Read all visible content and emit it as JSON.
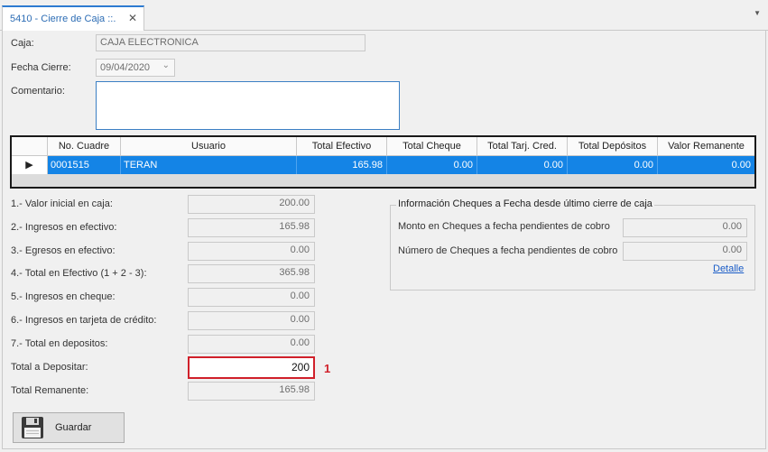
{
  "tab": {
    "title": "5410 - Cierre de Caja ::.",
    "close": "✕"
  },
  "form": {
    "caja_label": "Caja:",
    "caja_value": "CAJA ELECTRONICA",
    "fecha_label": "Fecha Cierre:",
    "fecha_value": "09/04/2020",
    "comentario_label": "Comentario:",
    "comentario_value": ""
  },
  "grid": {
    "columns": [
      "No. Cuadre",
      "Usuario",
      "Total Efectivo",
      "Total Cheque",
      "Total Tarj. Cred.",
      "Total Depósitos",
      "Valor Remanente"
    ],
    "row": {
      "no_cuadre": "0001515",
      "usuario": "TERAN",
      "total_efectivo": "165.98",
      "total_cheque": "0.00",
      "total_tarj": "0.00",
      "total_depositos": "0.00",
      "valor_remanente": "0.00"
    }
  },
  "summary": [
    {
      "label": "1.- Valor inicial en caja:",
      "value": "200.00"
    },
    {
      "label": "2.- Ingresos en efectivo:",
      "value": "165.98"
    },
    {
      "label": "3.- Egresos en efectivo:",
      "value": "0.00"
    },
    {
      "label": "4.- Total en Efectivo (1 + 2 - 3):",
      "value": "365.98"
    },
    {
      "label": "5.- Ingresos en cheque:",
      "value": "0.00"
    },
    {
      "label": "6.- Ingresos en tarjeta de crédito:",
      "value": "0.00"
    },
    {
      "label": "7.- Total en depositos:",
      "value": "0.00"
    }
  ],
  "deposit": {
    "label": "Total a Depositar:",
    "value": "200",
    "annotation": "1"
  },
  "remanente": {
    "label": "Total Remanente:",
    "value": "165.98"
  },
  "cheques": {
    "title": "Información Cheques a Fecha desde último cierre de caja",
    "monto_label": "Monto en Cheques a fecha pendientes de cobro",
    "monto_value": "0.00",
    "numero_label": "Número de Cheques a fecha pendientes de cobro",
    "numero_value": "0.00",
    "detalle_link": "Detalle"
  },
  "save_button": {
    "label": "Guardar",
    "icon": "floppy-disk-icon"
  },
  "colors": {
    "selection": "#1484e6",
    "highlight": "#d0202a",
    "accent": "#2d7bd1"
  }
}
